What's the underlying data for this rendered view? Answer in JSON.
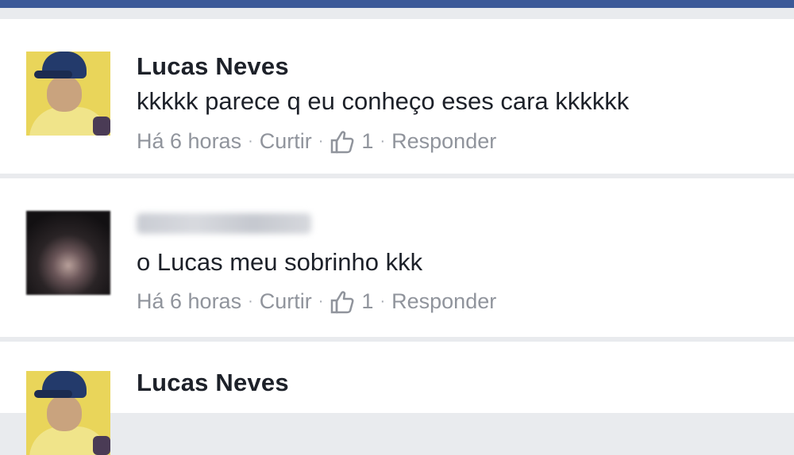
{
  "comments": [
    {
      "author": "Lucas Neves",
      "text": "kkkkk parece q eu conheço eses cara kkkkkk",
      "time": "Há 6 horas",
      "like_label": "Curtir",
      "like_count": "1",
      "reply_label": "Responder",
      "separator": "·",
      "like_icon": "thumbs-up-icon"
    },
    {
      "author_blurred": true,
      "text": "o Lucas meu sobrinho kkk",
      "time": "Há 6 horas",
      "like_label": "Curtir",
      "like_count": "1",
      "reply_label": "Responder",
      "separator": "·",
      "like_icon": "thumbs-up-icon"
    },
    {
      "author": "Lucas Neves"
    }
  ],
  "colors": {
    "header": "#3b5998",
    "background": "#e9ebee",
    "card": "#ffffff",
    "text": "#1d2129",
    "meta": "#90949c"
  }
}
